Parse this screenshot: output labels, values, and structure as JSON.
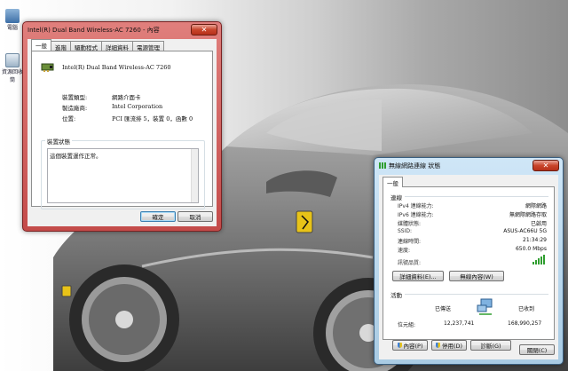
{
  "desktop": {
    "icons": [
      {
        "label": "電腦"
      },
      {
        "label": "資源回收筒"
      }
    ]
  },
  "props_window": {
    "title": "Intel(R) Dual Band Wireless-AC 7260 - 內容",
    "tabs": [
      "一般",
      "進階",
      "驅動程式",
      "詳細資料",
      "電源管理"
    ],
    "device_name": "Intel(R) Dual Band Wireless-AC 7260",
    "rows": [
      {
        "key": "裝置類型:",
        "value": "網路介面卡"
      },
      {
        "key": "製造廠商:",
        "value": "Intel Corporation"
      },
      {
        "key": "位置:",
        "value": "PCI 匯流排 5，裝置 0，函數 0"
      }
    ],
    "status_group_title": "裝置狀態",
    "status_text": "這個裝置運作正常。",
    "ok_label": "確定",
    "cancel_label": "取消"
  },
  "status_window": {
    "title": "無線網路連線 狀態",
    "tab": "一般",
    "connection_title": "連線",
    "rows": [
      {
        "key": "IPv4 連線能力:",
        "value": "網際網路"
      },
      {
        "key": "IPv6 連線能力:",
        "value": "無網際網路存取"
      },
      {
        "key": "媒體狀態:",
        "value": "已啟用"
      },
      {
        "key": "SSID:",
        "value": "ASUS-AC66U 5G"
      },
      {
        "key": "連線時間:",
        "value": "21:34:29"
      },
      {
        "key": "速度:",
        "value": "650.0 Mbps"
      }
    ],
    "signal_label": "訊號品質:",
    "details_label": "詳細資料(E)...",
    "wireless_props_label": "無線內容(W)",
    "activity_title": "活動",
    "sent_label": "已傳送",
    "received_label": "已收到",
    "bytes_label": "位元組:",
    "bytes_sent": "12,237,741",
    "bytes_received": "168,990,257",
    "properties_label": "內容(P)",
    "disable_label": "停用(D)",
    "diagnose_label": "診斷(G)",
    "close_label": "關閉(C)"
  },
  "colors": {
    "props_title_bg": "#c44b4a",
    "status_title_bg": "#a9cbe3",
    "signal": "#2f9e2f"
  }
}
